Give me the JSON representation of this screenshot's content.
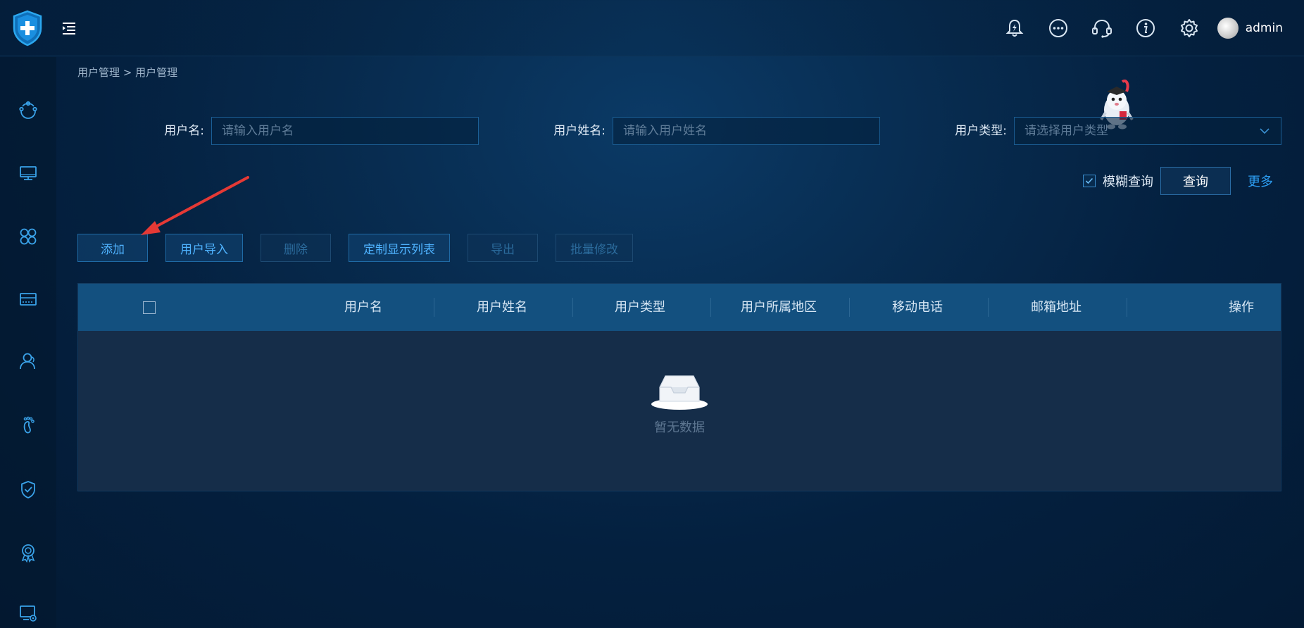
{
  "header": {
    "username": "admin",
    "icons": [
      "shield-plus-logo",
      "menu-toggle-icon",
      "bell-icon",
      "more-icon",
      "headset-icon",
      "info-icon",
      "gear-icon"
    ]
  },
  "sidebar": {
    "icons": [
      "network-icon",
      "monitor-icon",
      "apps-icon",
      "storage-icon",
      "user-icon",
      "footprint-icon",
      "shield-check-icon",
      "award-icon",
      "screen-settings-icon"
    ]
  },
  "breadcrumb": "用户管理 > 用户管理",
  "search": {
    "username_label": "用户名:",
    "username_placeholder": "请输入用户名",
    "fullname_label": "用户姓名:",
    "fullname_placeholder": "请输入用户姓名",
    "type_label": "用户类型:",
    "type_placeholder": "请选择用户类型",
    "fuzzy_label": "模糊查询",
    "fuzzy_checked": true,
    "query_label": "查询",
    "more_label": "更多"
  },
  "toolbar": {
    "add": "添加",
    "import": "用户导入",
    "delete": "删除",
    "custom_columns": "定制显示列表",
    "export": "导出",
    "batch_edit": "批量修改"
  },
  "table": {
    "columns": [
      "用户名",
      "用户姓名",
      "用户类型",
      "用户所属地区",
      "移动电话",
      "邮箱地址",
      "操作"
    ],
    "rows": [],
    "empty_text": "暂无数据"
  },
  "colors": {
    "accent": "#2c9cf0",
    "button_text": "#4fb3ff",
    "table_header": "#13507f",
    "annotation_arrow": "#e53935"
  }
}
